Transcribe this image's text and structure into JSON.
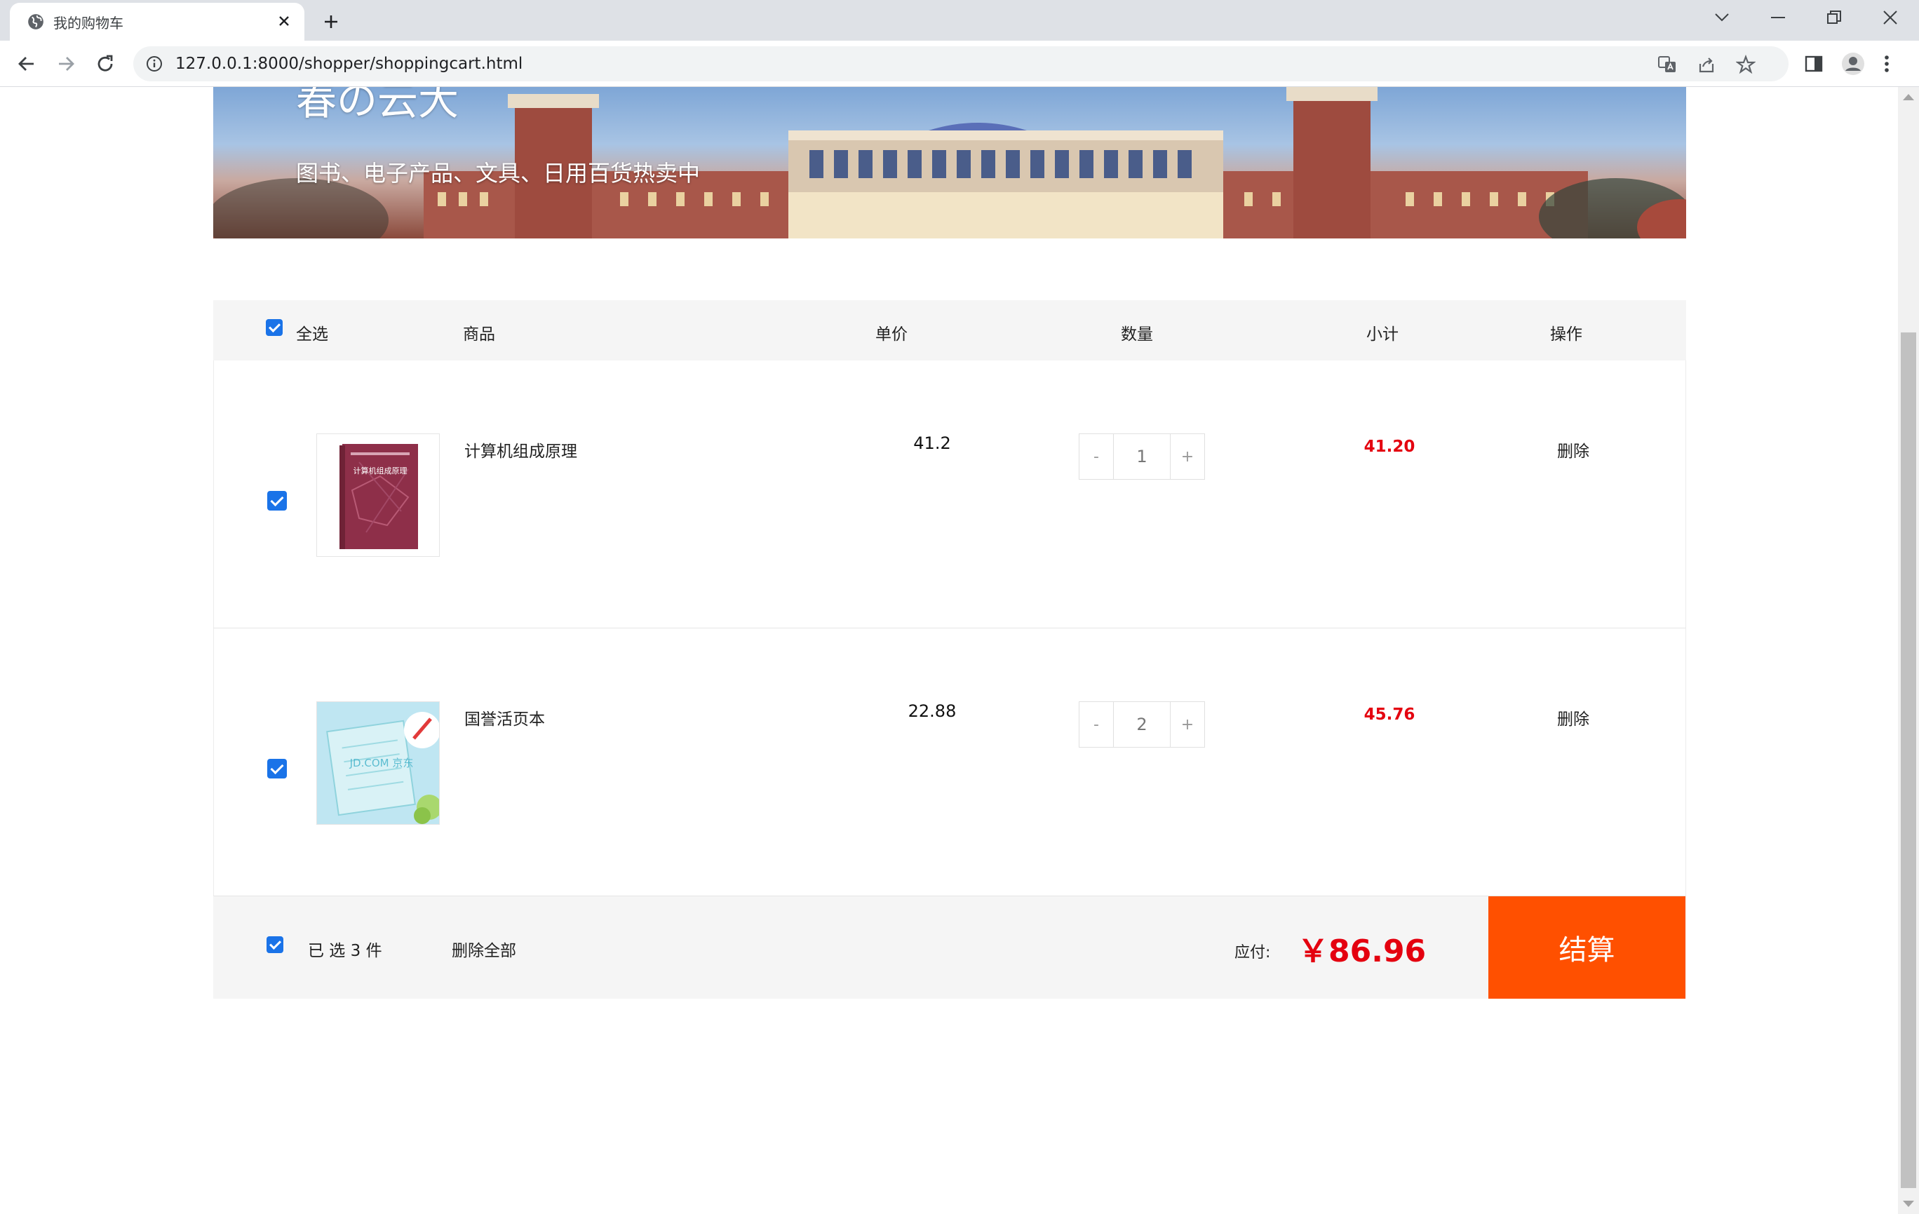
{
  "browser": {
    "tab_title": "我的购物车",
    "url": "127.0.0.1:8000/shopper/shoppingcart.html"
  },
  "banner": {
    "brand": "春の云大",
    "slogan": "图书、电子产品、文具、日用百货热卖中"
  },
  "cart": {
    "headers": {
      "select_all": "全选",
      "product": "商品",
      "unit_price": "单价",
      "quantity": "数量",
      "subtotal": "小计",
      "action": "操作"
    },
    "items": [
      {
        "name": "计算机组成原理",
        "price": "41.2",
        "qty": "1",
        "subtotal": "41.20",
        "action": "删除",
        "checked": true,
        "thumb_icon": "book-cover-icon",
        "thumb_text": "计算机组成原理"
      },
      {
        "name": "国誉活页本",
        "price": "22.88",
        "qty": "2",
        "subtotal": "45.76",
        "action": "删除",
        "checked": true,
        "thumb_icon": "notebook-product-icon",
        "thumb_text": "JD.COM 京东"
      }
    ],
    "qty_minus": "-",
    "qty_plus": "+",
    "footer": {
      "selected_text": "已 选 3 件",
      "delete_all": "删除全部",
      "payable_label": "应付:",
      "total": "￥86.96",
      "checkout": "结算"
    }
  },
  "colors": {
    "accent_red": "#e4000f",
    "checkout_orange": "#ff5000",
    "checkbox_blue": "#1a73e8"
  }
}
